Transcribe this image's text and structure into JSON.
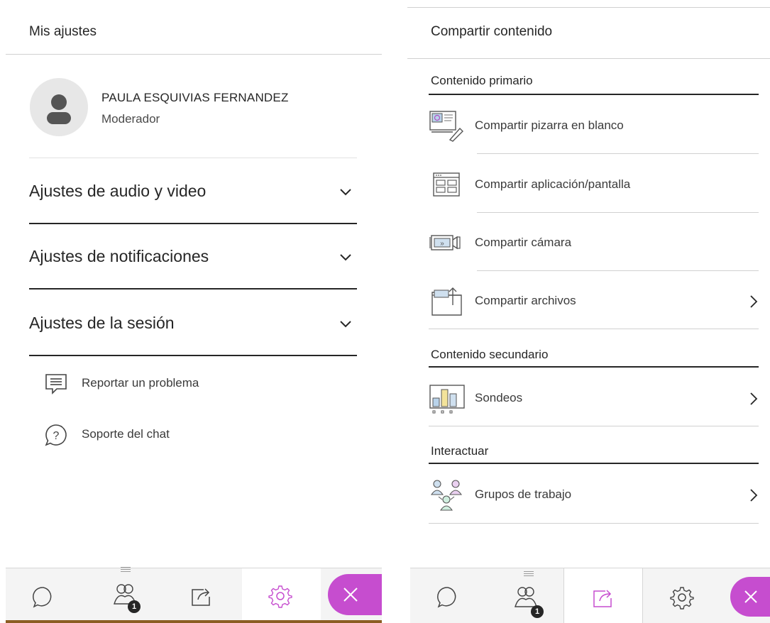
{
  "settings_panel": {
    "title": "Mis ajustes",
    "user": {
      "name": "PAULA ESQUIVIAS FERNANDEZ",
      "role": "Moderador"
    },
    "sections": [
      {
        "label": "Ajustes de audio y video",
        "icon": "chevron-down-icon"
      },
      {
        "label": "Ajustes de notificaciones",
        "icon": "chevron-down-icon"
      },
      {
        "label": "Ajustes de la sesión",
        "icon": "chevron-down-icon"
      }
    ],
    "links": [
      {
        "label": "Reportar un problema",
        "icon": "report-problem-icon"
      },
      {
        "label": "Soporte del chat",
        "icon": "help-chat-icon"
      }
    ]
  },
  "share_panel": {
    "title": "Compartir contenido",
    "groups": [
      {
        "heading": "Contenido primario",
        "items": [
          {
            "label": "Compartir pizarra en blanco",
            "icon": "whiteboard-icon",
            "has_chevron": false
          },
          {
            "label": "Compartir aplicación/pantalla",
            "icon": "screen-share-icon",
            "has_chevron": false
          },
          {
            "label": "Compartir cámara",
            "icon": "camera-share-icon",
            "has_chevron": false
          },
          {
            "label": "Compartir archivos",
            "icon": "folder-share-icon",
            "has_chevron": true
          }
        ]
      },
      {
        "heading": "Contenido secundario",
        "items": [
          {
            "label": "Sondeos",
            "icon": "polls-icon",
            "has_chevron": true
          }
        ]
      },
      {
        "heading": "Interactuar",
        "items": [
          {
            "label": "Grupos de trabajo",
            "icon": "breakout-groups-icon",
            "has_chevron": true
          }
        ]
      }
    ]
  },
  "tabbar": {
    "tabs": [
      "chat-icon",
      "attendees-icon",
      "share-content-icon",
      "settings-icon"
    ],
    "attendee_badge": "1",
    "left_active_tab": "settings-icon",
    "right_active_tab": "share-content-icon",
    "close_icon": "close-icon"
  },
  "colors": {
    "accent": "#c64dcf",
    "active_tab_indicator": "#8e44ad",
    "text": "#262626",
    "divider": "#d0d0d0",
    "avatar_bg": "#e7e7e7",
    "avatar_fg": "#555555",
    "tabbar_bg": "#f4f4f4"
  }
}
